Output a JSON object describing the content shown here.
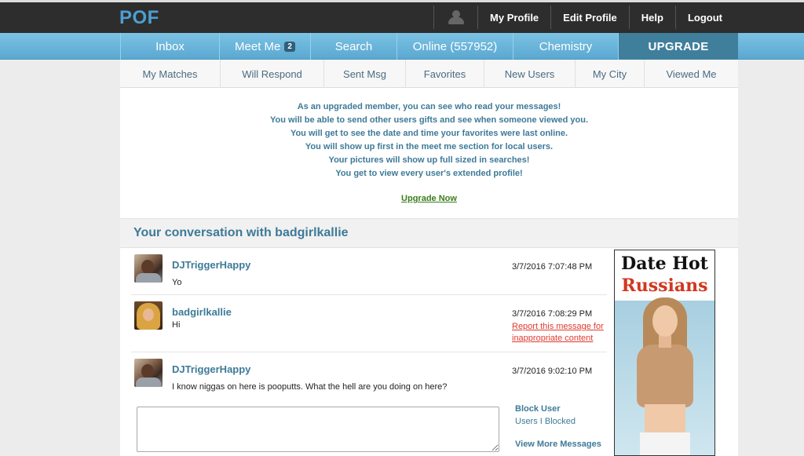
{
  "topbar": {
    "logo": "POF",
    "nav": [
      "My Profile",
      "Edit Profile",
      "Help",
      "Logout"
    ]
  },
  "mainnav": {
    "tabs": [
      {
        "label": "Inbox"
      },
      {
        "label": "Meet Me",
        "badge": "2"
      },
      {
        "label": "Search"
      },
      {
        "label": "Online (557952)"
      },
      {
        "label": "Chemistry"
      },
      {
        "label": "UPGRADE"
      }
    ]
  },
  "subnav": {
    "items": [
      "My Matches",
      "Will Respond",
      "Sent Msg",
      "Favorites",
      "New Users",
      "My City",
      "Viewed Me"
    ]
  },
  "promo": {
    "lines": [
      "As an upgraded member, you can see who read your messages!",
      "You will be able to send other users gifts and see when someone viewed you.",
      "You will get to see the date and time your favorites were last online.",
      "You will show up first in the meet me section for local users.",
      "Your pictures will show up full sized in searches!",
      "You get to view every user's extended profile!"
    ],
    "link": "Upgrade Now"
  },
  "conversation": {
    "title": "Your conversation with badgirlkallie",
    "messages": [
      {
        "sender": "DJTriggerHappy",
        "text": "Yo",
        "time": "3/7/2016 7:07:48 PM"
      },
      {
        "sender": "badgirlkallie",
        "text": "Hi",
        "time": "3/7/2016 7:08:29 PM",
        "report": "Report this message for inappropriate content"
      },
      {
        "sender": "DJTriggerHappy",
        "text": "I know niggas on here is pooputts. What the hell are you doing on here?",
        "time": "3/7/2016 9:02:10 PM"
      }
    ],
    "compose_value": "",
    "block_user": "Block User",
    "users_blocked": "Users I Blocked",
    "view_more": "View More Messages"
  },
  "ad": {
    "line1": "Date Hot",
    "line2": "Russians"
  }
}
